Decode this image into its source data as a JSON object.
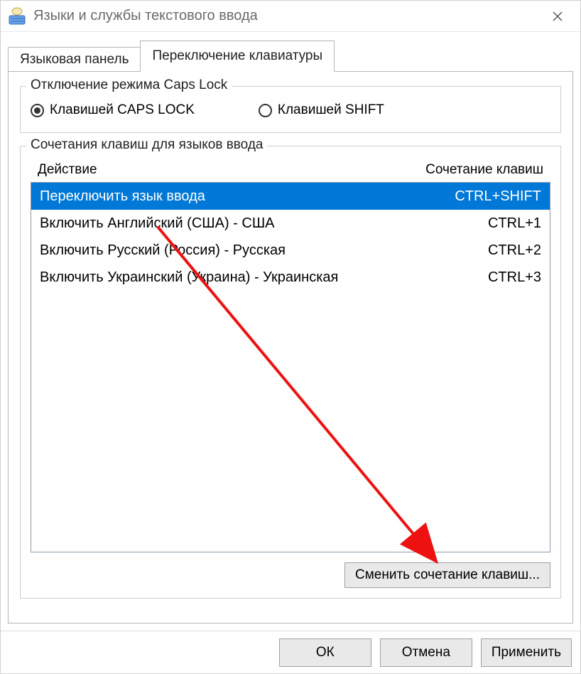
{
  "window": {
    "title": "Языки и службы текстового ввода"
  },
  "tabs": [
    {
      "label": "Языковая панель",
      "active": false
    },
    {
      "label": "Переключение клавиатуры",
      "active": true
    }
  ],
  "capslock_group": {
    "title": "Отключение режима Caps Lock",
    "options": [
      {
        "label": "Клавишей CAPS LOCK",
        "checked": true
      },
      {
        "label": "Клавишей SHIFT",
        "checked": false
      }
    ]
  },
  "hotkeys_group": {
    "title": "Сочетания клавиш для языков ввода",
    "headers": {
      "action": "Действие",
      "shortcut": "Сочетание клавиш"
    },
    "rows": [
      {
        "action": "Переключить язык ввода",
        "shortcut": "CTRL+SHIFT",
        "selected": true
      },
      {
        "action": "Включить Английский (США) - США",
        "shortcut": "CTRL+1",
        "selected": false
      },
      {
        "action": "Включить Русский (Россия) - Русская",
        "shortcut": "CTRL+2",
        "selected": false
      },
      {
        "action": "Включить Украинский (Украина) - Украинская",
        "shortcut": "CTRL+3",
        "selected": false
      }
    ],
    "change_button": "Сменить сочетание клавиш..."
  },
  "buttons": {
    "ok": "ОК",
    "cancel": "Отмена",
    "apply": "Применить"
  }
}
